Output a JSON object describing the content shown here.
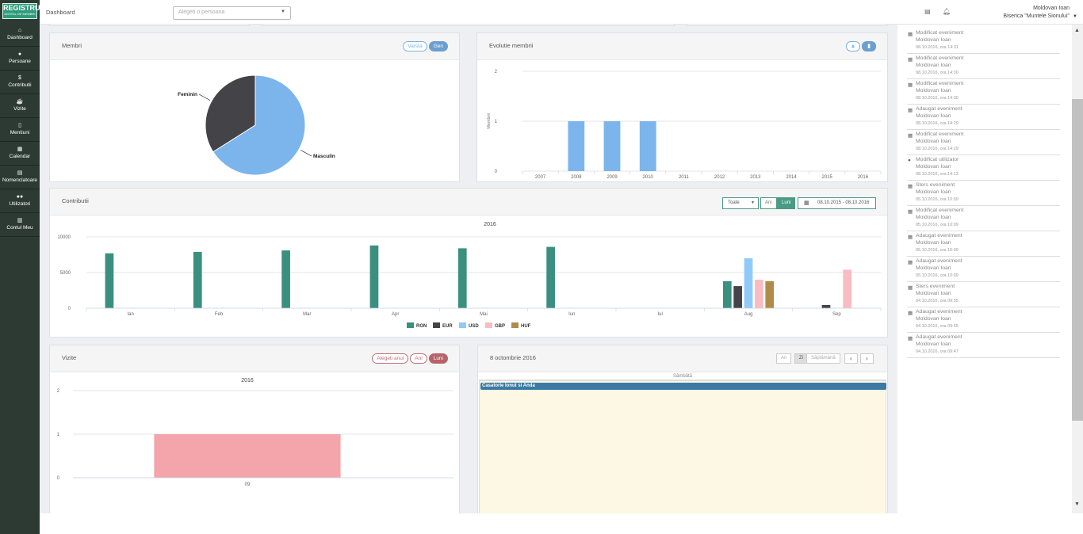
{
  "app": {
    "logo_main": "REGISTRU",
    "logo_sub": "DIGITAL DE MEMBRI"
  },
  "sidebar": {
    "items": [
      {
        "label": "Dashboard",
        "icon": "home-icon",
        "glyph": "⌂"
      },
      {
        "label": "Persoane",
        "icon": "person-icon",
        "glyph": "●"
      },
      {
        "label": "Contributii",
        "icon": "dollar-icon",
        "glyph": "$"
      },
      {
        "label": "Vizite",
        "icon": "coffee-icon",
        "glyph": "☕"
      },
      {
        "label": "Mentiuni",
        "icon": "document-icon",
        "glyph": "▯"
      },
      {
        "label": "Calendar",
        "icon": "calendar-icon",
        "glyph": "▦"
      },
      {
        "label": "Nomenclatoare",
        "icon": "book-icon",
        "glyph": "▤"
      },
      {
        "label": "Utilizatori",
        "icon": "users-icon",
        "glyph": "●●"
      },
      {
        "label": "Contul Meu",
        "icon": "account-icon",
        "glyph": "▥"
      }
    ]
  },
  "header": {
    "breadcrumb": "Dashboard",
    "person_select_placeholder": "Alegeti o persoana",
    "user_name": "Moldovan Ioan",
    "user_org": "Biserica \"Muntele Sionului\""
  },
  "membri": {
    "title": "Membri",
    "btn_varsta": "Varsta",
    "btn_gen": "Gen"
  },
  "evolutie": {
    "title": "Evolutie membrii"
  },
  "contributii": {
    "title": "Contributii",
    "select_value": "Toate",
    "btn_ani": "Ani",
    "btn_luni": "Luni",
    "date_range": "08.10.2015 - 08.10.2016"
  },
  "vizite": {
    "title": "Vizite",
    "btn_select_year": "Alegeti anul",
    "btn_ani": "Ani",
    "btn_luni": "Luni"
  },
  "calendar": {
    "title": "8 octombrie 2016",
    "btn_an": "An",
    "btn_zi": "Zi",
    "btn_saptamana": "Săptămână",
    "prev": "‹",
    "next": "›",
    "day_header": "Sâmbătă",
    "event": "Casatorie Ionut si Anda"
  },
  "activity": [
    {
      "action": "Modificat eveniment",
      "user": "Moldovan Ioan",
      "time": "08.10.2016, ora 14:31",
      "icon": "calendar-icon"
    },
    {
      "action": "Modificat eveniment",
      "user": "Moldovan Ioan",
      "time": "08.10.2016, ora 14:30",
      "icon": "calendar-icon"
    },
    {
      "action": "Modificat eveniment",
      "user": "Moldovan Ioan",
      "time": "08.10.2016, ora 14:30",
      "icon": "calendar-icon"
    },
    {
      "action": "Adaugat eveniment",
      "user": "Moldovan Ioan",
      "time": "08.10.2016, ora 14:29",
      "icon": "calendar-icon"
    },
    {
      "action": "Modificat eveniment",
      "user": "Moldovan Ioan",
      "time": "08.10.2016, ora 14:29",
      "icon": "calendar-icon"
    },
    {
      "action": "Modificat utilizator",
      "user": "Moldovan Ioan",
      "time": "08.10.2016, ora 14:13",
      "icon": "user-icon"
    },
    {
      "action": "Sters eveniment",
      "user": "Moldovan Ioan",
      "time": "05.10.2016, ora 10:09",
      "icon": "calendar-icon"
    },
    {
      "action": "Modificat eveniment",
      "user": "Moldovan Ioan",
      "time": "05.10.2016, ora 10:09",
      "icon": "calendar-icon"
    },
    {
      "action": "Adaugat eveniment",
      "user": "Moldovan Ioan",
      "time": "05.10.2016, ora 10:09",
      "icon": "calendar-icon"
    },
    {
      "action": "Adaugat eveniment",
      "user": "Moldovan Ioan",
      "time": "05.10.2016, ora 10:09",
      "icon": "calendar-icon"
    },
    {
      "action": "Sters eveniment",
      "user": "Moldovan Ioan",
      "time": "04.10.2016, ora 09:55",
      "icon": "calendar-icon"
    },
    {
      "action": "Adaugat eveniment",
      "user": "Moldovan Ioan",
      "time": "04.10.2016, ora 09:55",
      "icon": "calendar-icon"
    },
    {
      "action": "Adaugat eveniment",
      "user": "Moldovan Ioan",
      "time": "04.10.2016, ora 09:47",
      "icon": "calendar-icon"
    }
  ],
  "colors": {
    "sidebar": "#2c3a33",
    "accent": "#4a9b86",
    "masculin": "#7cb5ec",
    "feminin": "#434348",
    "vizite": "#f4a5ab"
  },
  "chart_data": [
    {
      "type": "pie",
      "categories": [
        "Feminin",
        "Masculin"
      ],
      "values": [
        34,
        66
      ],
      "colors": [
        "#434348",
        "#7cb5ec"
      ]
    },
    {
      "type": "bar",
      "categories": [
        "2007",
        "2008",
        "2009",
        "2010",
        "2011",
        "2012",
        "2013",
        "2014",
        "2015",
        "2016"
      ],
      "values": [
        0,
        1,
        1,
        1,
        0,
        0,
        0,
        0,
        0,
        0
      ],
      "ylabel": "Membrii",
      "ylim": [
        0,
        2
      ],
      "yticks": [
        "0",
        "1",
        "2"
      ],
      "color": "#7cb5ec"
    },
    {
      "type": "bar",
      "title": "2016",
      "categories": [
        "Ian",
        "Feb",
        "Mar",
        "Apr",
        "Mai",
        "Iun",
        "Iul",
        "Aug",
        "Sep"
      ],
      "ylim": [
        0,
        10000
      ],
      "yticks": [
        "0",
        "5000",
        "10000"
      ],
      "series": [
        {
          "name": "RON",
          "color": "#3a8f7f",
          "values": [
            7700,
            7900,
            8100,
            8800,
            8400,
            8600,
            0,
            3800,
            0
          ]
        },
        {
          "name": "EUR",
          "color": "#434348",
          "values": [
            0,
            0,
            0,
            0,
            0,
            0,
            0,
            3100,
            450
          ]
        },
        {
          "name": "USD",
          "color": "#90caf9",
          "values": [
            0,
            0,
            0,
            0,
            0,
            0,
            0,
            7000,
            0
          ]
        },
        {
          "name": "GBP",
          "color": "#f9bcc2",
          "values": [
            0,
            0,
            0,
            0,
            0,
            0,
            0,
            4000,
            5400
          ]
        },
        {
          "name": "HUF",
          "color": "#b08c4a",
          "values": [
            0,
            0,
            0,
            0,
            0,
            0,
            0,
            3800,
            0
          ]
        }
      ],
      "legend": "bottom"
    },
    {
      "type": "bar",
      "title": "2016",
      "categories": [
        "09"
      ],
      "values": [
        1
      ],
      "ylim": [
        0,
        2
      ],
      "yticks": [
        "0",
        "1",
        "2"
      ],
      "color": "#f4a5ab"
    }
  ]
}
